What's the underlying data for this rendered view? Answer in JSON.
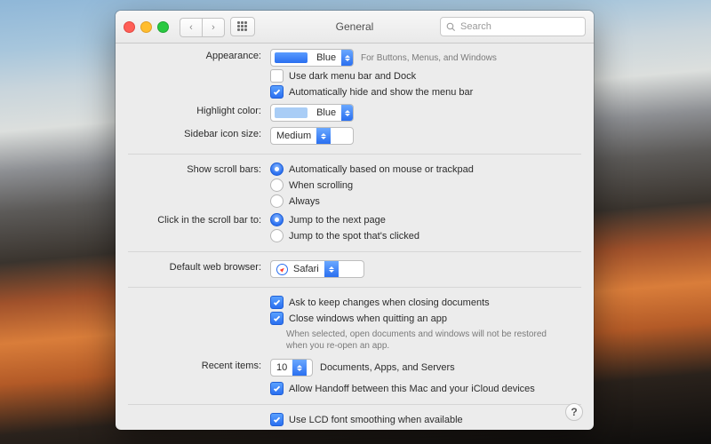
{
  "toolbar": {
    "title": "General",
    "search_placeholder": "Search"
  },
  "appearance": {
    "label": "Appearance:",
    "value": "Blue",
    "hint": "For Buttons, Menus, and Windows",
    "dark_menu": "Use dark menu bar and Dock",
    "auto_hide_menu": "Automatically hide and show the menu bar"
  },
  "highlight": {
    "label": "Highlight color:",
    "value": "Blue"
  },
  "sidebar_icon": {
    "label": "Sidebar icon size:",
    "value": "Medium"
  },
  "scrollbars": {
    "label": "Show scroll bars:",
    "opt_auto": "Automatically based on mouse or trackpad",
    "opt_scrolling": "When scrolling",
    "opt_always": "Always"
  },
  "click_scrollbar": {
    "label": "Click in the scroll bar to:",
    "opt_next": "Jump to the next page",
    "opt_spot": "Jump to the spot that's clicked"
  },
  "browser": {
    "label": "Default web browser:",
    "value": "Safari"
  },
  "docs": {
    "ask_changes": "Ask to keep changes when closing documents",
    "close_windows": "Close windows when quitting an app",
    "close_hint": "When selected, open documents and windows will not be restored when you re-open an app."
  },
  "recent": {
    "label": "Recent items:",
    "value": "10",
    "suffix": "Documents, Apps, and Servers"
  },
  "handoff": {
    "label": "Allow Handoff between this Mac and your iCloud devices"
  },
  "lcd": {
    "label": "Use LCD font smoothing when available"
  },
  "help": "?"
}
